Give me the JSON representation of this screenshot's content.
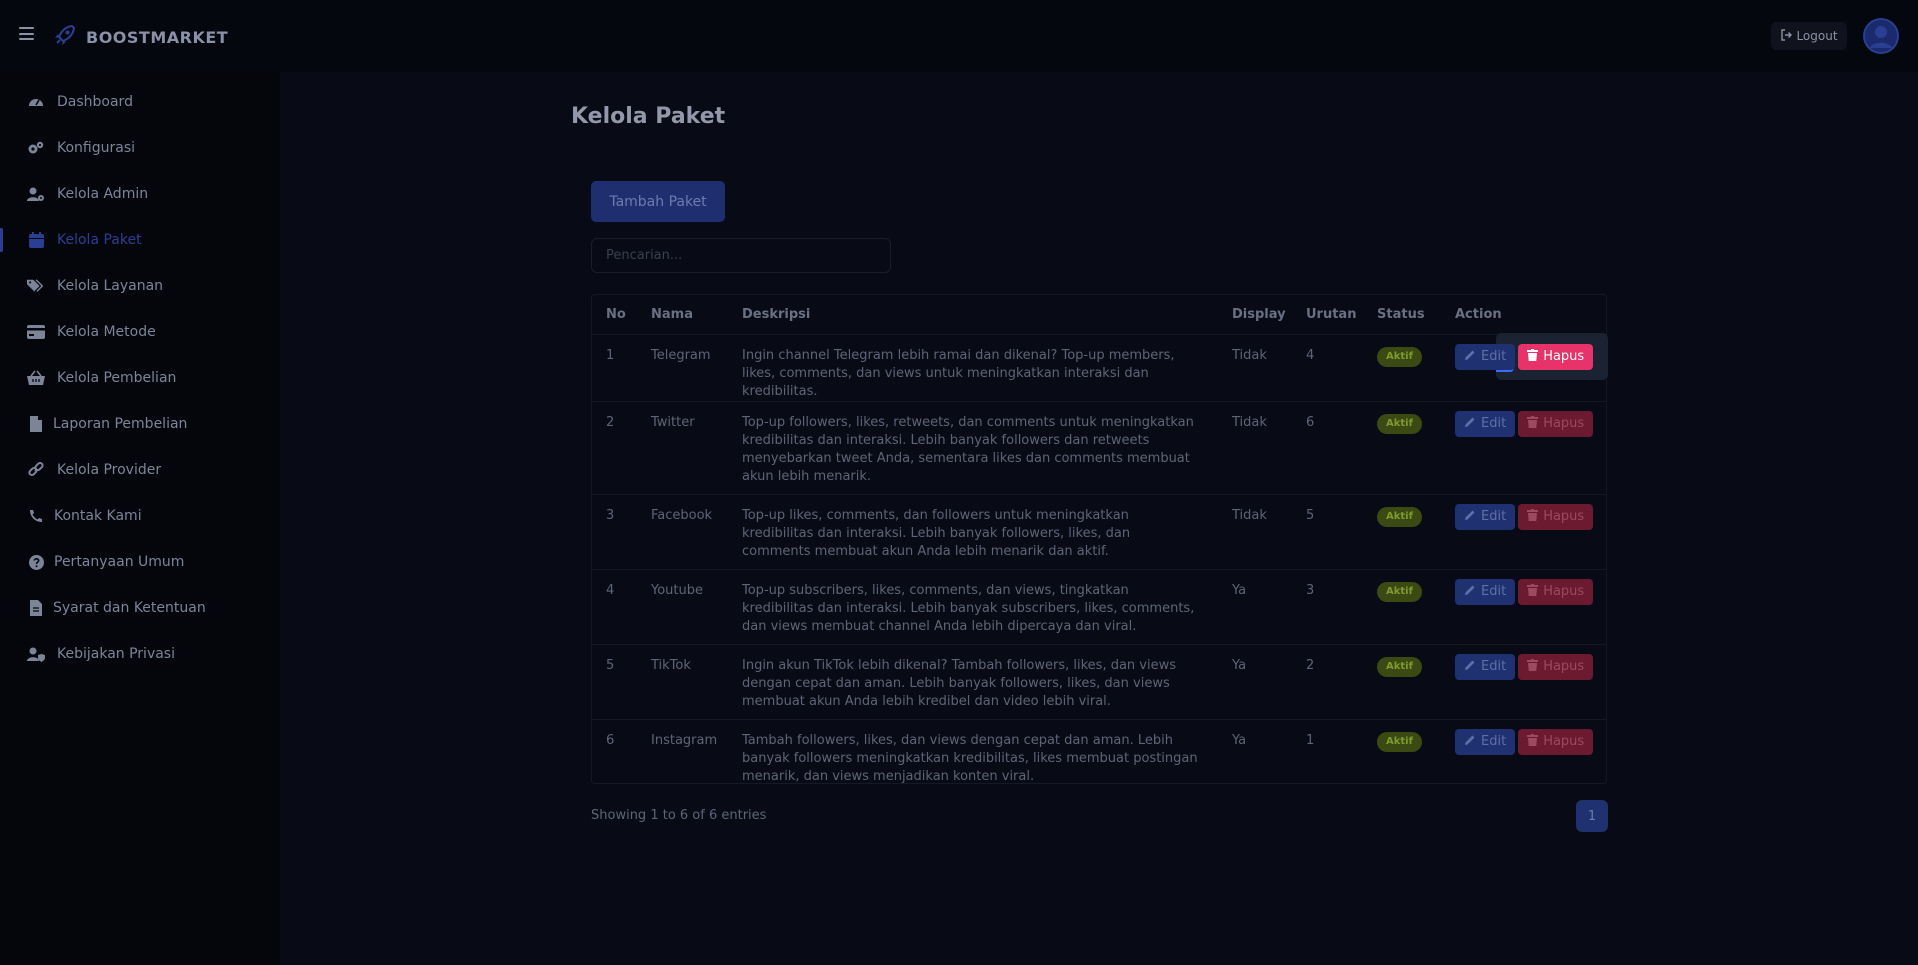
{
  "brand": {
    "name": "BOOSTMARKET"
  },
  "topbar": {
    "logout_label": "Logout"
  },
  "sidebar": {
    "items": [
      {
        "label": "Dashboard",
        "icon": "gauge-icon"
      },
      {
        "label": "Konfigurasi",
        "icon": "gears-icon"
      },
      {
        "label": "Kelola Admin",
        "icon": "user-gear-icon"
      },
      {
        "label": "Kelola Paket",
        "icon": "calendar-icon",
        "active": true
      },
      {
        "label": "Kelola Layanan",
        "icon": "tags-icon"
      },
      {
        "label": "Kelola Metode",
        "icon": "credit-card-icon"
      },
      {
        "label": "Kelola Pembelian",
        "icon": "basket-icon"
      },
      {
        "label": "Laporan Pembelian",
        "icon": "file-icon"
      },
      {
        "label": "Kelola Provider",
        "icon": "link-icon"
      },
      {
        "label": "Kontak Kami",
        "icon": "phone-icon"
      },
      {
        "label": "Pertanyaan Umum",
        "icon": "question-icon"
      },
      {
        "label": "Syarat dan Ketentuan",
        "icon": "file-lines-icon"
      },
      {
        "label": "Kebijakan Privasi",
        "icon": "user-shield-icon"
      }
    ]
  },
  "main": {
    "title": "Kelola Paket",
    "add_button": "Tambah Paket",
    "search_placeholder": "Pencarian...",
    "columns": [
      "No",
      "Nama",
      "Deskripsi",
      "Display",
      "Urutan",
      "Status",
      "Action"
    ],
    "rows": [
      {
        "no": "1",
        "nama": "Telegram",
        "deskripsi": "Ingin channel Telegram lebih ramai dan dikenal? Top-up members, likes, comments, dan views untuk meningkatkan interaksi dan kredibilitas.",
        "display": "Tidak",
        "urutan": "4",
        "status": "Aktif"
      },
      {
        "no": "2",
        "nama": "Twitter",
        "deskripsi": "Top-up followers, likes, retweets, dan comments untuk meningkatkan kredibilitas dan interaksi. Lebih banyak followers dan retweets menyebarkan tweet Anda, sementara likes dan comments membuat akun lebih menarik.",
        "display": "Tidak",
        "urutan": "6",
        "status": "Aktif"
      },
      {
        "no": "3",
        "nama": "Facebook",
        "deskripsi": "Top-up likes, comments, dan followers untuk meningkatkan kredibilitas dan interaksi. Lebih banyak followers, likes, dan comments membuat akun Anda lebih menarik dan aktif.",
        "display": "Tidak",
        "urutan": "5",
        "status": "Aktif"
      },
      {
        "no": "4",
        "nama": "Youtube",
        "deskripsi": "Top-up subscribers, likes, comments, dan views, tingkatkan kredibilitas dan interaksi. Lebih banyak subscribers, likes, comments, dan views membuat channel Anda lebih dipercaya dan viral.",
        "display": "Ya",
        "urutan": "3",
        "status": "Aktif"
      },
      {
        "no": "5",
        "nama": "TikTok",
        "deskripsi": "Ingin akun TikTok lebih dikenal? Tambah followers, likes, dan views dengan cepat dan aman. Lebih banyak followers, likes, dan views membuat akun Anda lebih kredibel dan video lebih viral.",
        "display": "Ya",
        "urutan": "2",
        "status": "Aktif"
      },
      {
        "no": "6",
        "nama": "Instagram",
        "deskripsi": "Tambah followers, likes, dan views dengan cepat dan aman. Lebih banyak followers meningkatkan kredibilitas, likes membuat postingan menarik, dan views menjadikan konten viral.",
        "display": "Ya",
        "urutan": "1",
        "status": "Aktif"
      }
    ],
    "edit_label": "Edit",
    "delete_label": "Hapus",
    "footer_info": "Showing 1 to 6 of 6 entries",
    "page": "1"
  },
  "colors": {
    "background": "#080b16",
    "accent": "#1f3170",
    "danger": "#e8326a",
    "success": "#3a4a12"
  }
}
